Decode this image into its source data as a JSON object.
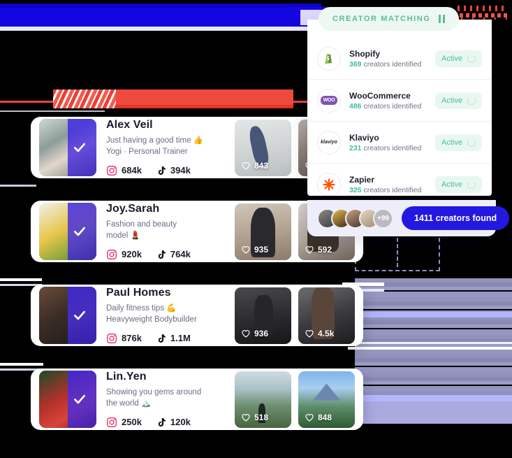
{
  "theme": {
    "accent_blue": "#2318e0",
    "accent_green": "#4dbe98",
    "glitch_red": "#ef4136",
    "glitch_purple": "#9a9ac4",
    "card_bg": "#ffffff",
    "page_bg": "#000000"
  },
  "panel": {
    "title": "CREATOR MATCHING",
    "pause_icon": "pause-icon",
    "rows": [
      {
        "name": "Shopify",
        "count": "369",
        "count_suffix": "creators identified",
        "status": "Active",
        "logo": "shopify-logo"
      },
      {
        "name": "WooCommerce",
        "count": "486",
        "count_suffix": "creators identified",
        "status": "Active",
        "logo": "woocommerce-logo"
      },
      {
        "name": "Klaviyo",
        "count": "231",
        "count_suffix": "creators identified",
        "status": "Active",
        "logo": "klaviyo-logo"
      },
      {
        "name": "Zapier",
        "count": "325",
        "count_suffix": "creators identified",
        "status": "Active",
        "logo": "zapier-logo"
      }
    ],
    "footer": {
      "avatar_overflow": "+99",
      "cta_label": "1411 creators found"
    }
  },
  "creators": [
    {
      "name": "Alex Veil",
      "desc_line1": "Just having a good time 👍",
      "desc_line2": "Yogi · Personal Trainer",
      "instagram": "684k",
      "tiktok": "394k",
      "verified_icon": "check-icon",
      "posts": [
        {
          "likes": "843"
        },
        {
          "likes": ""
        }
      ]
    },
    {
      "name": "Joy.Sarah",
      "desc_line1": "Fashion and beauty",
      "desc_line2": "model 💄",
      "instagram": "920k",
      "tiktok": "764k",
      "verified_icon": "check-icon",
      "posts": [
        {
          "likes": "935"
        },
        {
          "likes": "592"
        }
      ]
    },
    {
      "name": "Paul Homes",
      "desc_line1": "Daily fitness tips 💪",
      "desc_line2": "Heavyweight Bodybuilder",
      "instagram": "876k",
      "tiktok": "1.1M",
      "verified_icon": "check-icon",
      "posts": [
        {
          "likes": "936"
        },
        {
          "likes": "4.5k"
        }
      ]
    },
    {
      "name": "Lin.Yen",
      "desc_line1": "Showing you gems around",
      "desc_line2": "the world 🏔️",
      "instagram": "250k",
      "tiktok": "120k",
      "verified_icon": "check-icon",
      "posts": [
        {
          "likes": "518"
        },
        {
          "likes": "848"
        }
      ]
    }
  ],
  "icons": {
    "instagram": "instagram-icon",
    "tiktok": "tiktok-icon",
    "heart": "heart-icon"
  }
}
